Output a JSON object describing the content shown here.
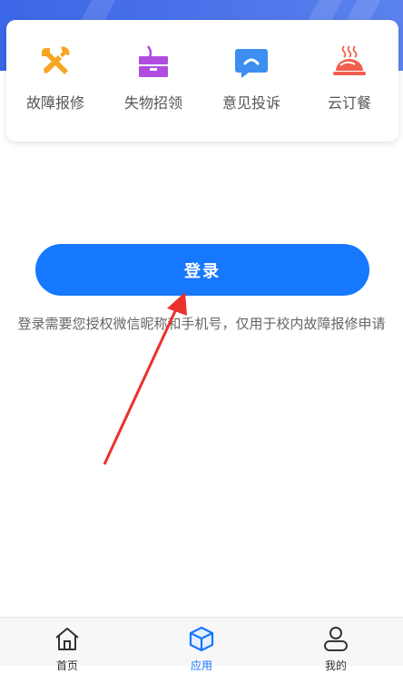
{
  "menu": {
    "items": [
      {
        "label": "故障报修",
        "icon": "tools-icon"
      },
      {
        "label": "失物招领",
        "icon": "lost-found-box-icon"
      },
      {
        "label": "意见投诉",
        "icon": "chat-bubble-icon"
      },
      {
        "label": "云订餐",
        "icon": "meal-dish-icon"
      }
    ]
  },
  "login": {
    "button_label": "登录",
    "note": "登录需要您授权微信昵称和手机号，仅用于校内故障报修申请"
  },
  "tabbar": {
    "items": [
      {
        "label": "首页",
        "icon": "home-icon",
        "active": false
      },
      {
        "label": "应用",
        "icon": "apps-cube-icon",
        "active": true
      },
      {
        "label": "我的",
        "icon": "user-icon",
        "active": false
      }
    ]
  },
  "colors": {
    "primary": "#1677ff",
    "header_gradient_start": "#3b66e6",
    "tools_icon": "#f5a623",
    "lost_found_icon": "#b04de0",
    "chat_icon": "#3d8ef0",
    "meal_icon": "#f0604d",
    "annotation_arrow": "#e8322b"
  }
}
